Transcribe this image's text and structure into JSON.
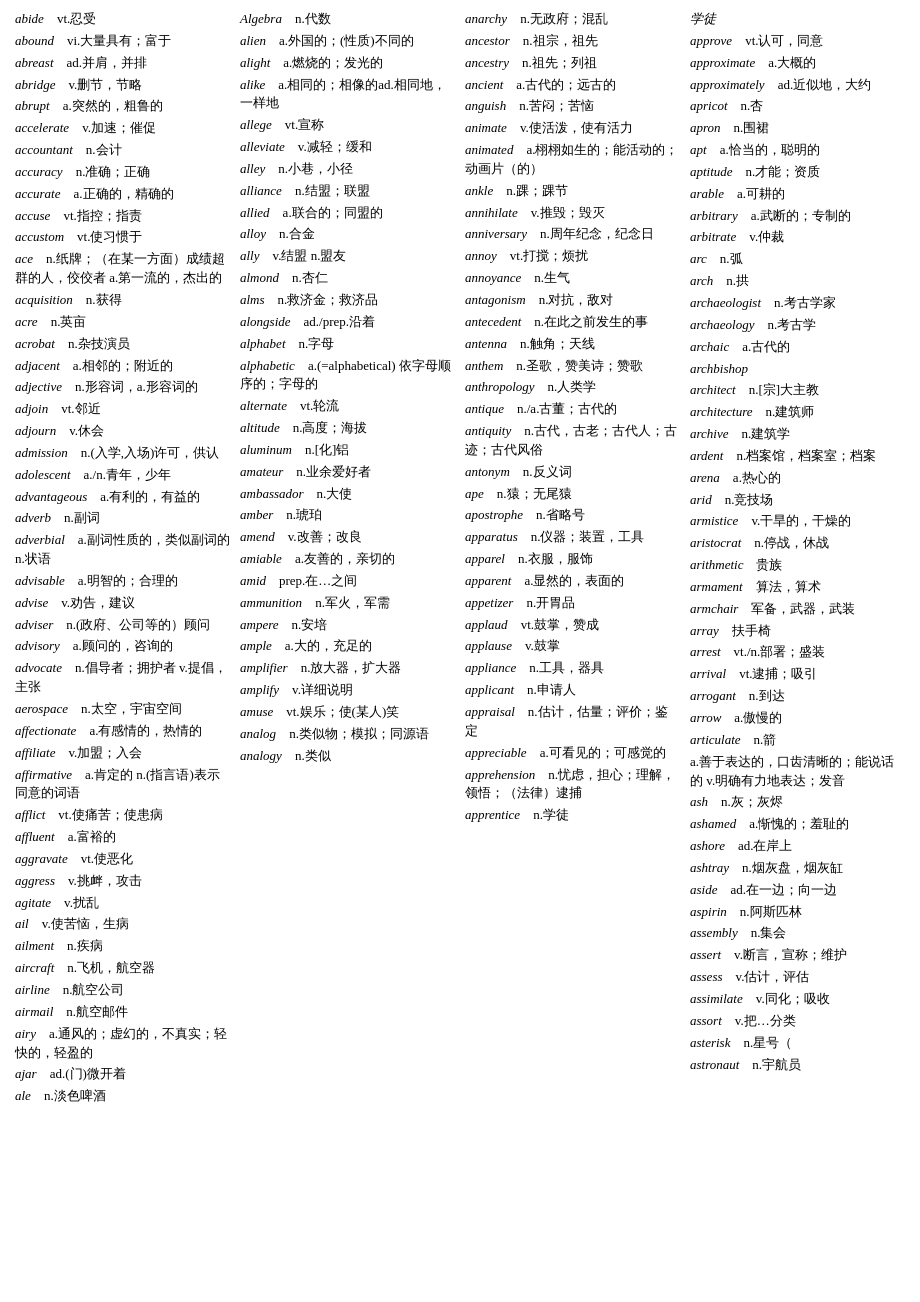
{
  "columns": [
    {
      "id": "col1",
      "entries": [
        {
          "word": "abide",
          "def": "vt.忍受"
        },
        {
          "word": "abound",
          "def": "vi.大量具有；富于"
        },
        {
          "word": "abreast",
          "def": "ad.并肩，并排"
        },
        {
          "word": "abridge",
          "def": "v.删节，节略"
        },
        {
          "word": "abrupt",
          "def": "a.突然的，粗鲁的"
        },
        {
          "word": "accelerate",
          "def": "v.加速；催促"
        },
        {
          "word": "accountant",
          "def": "n.会计"
        },
        {
          "word": "accuracy",
          "def": "n.准确；正确"
        },
        {
          "word": "accurate",
          "def": "a.正确的，精确的"
        },
        {
          "word": "accuse",
          "def": "vt.指控；指责"
        },
        {
          "word": "accustom",
          "def": "vt.使习惯于"
        },
        {
          "word": "ace",
          "def": "n.纸牌；（在某一方面）成绩超群的人，佼佼者 a.第一流的，杰出的"
        },
        {
          "word": "acquisition",
          "def": "n.获得"
        },
        {
          "word": "acre",
          "def": "n.英亩"
        },
        {
          "word": "acrobat",
          "def": "n.杂技演员"
        },
        {
          "word": "adjacent",
          "def": "a.相邻的；附近的"
        },
        {
          "word": "adjective",
          "def": "n.形容词，a.形容词的"
        },
        {
          "word": "adjoin",
          "def": "vt.邻近"
        },
        {
          "word": "adjourn",
          "def": "v.休会"
        },
        {
          "word": "admission",
          "def": "n.(入学,入场)许可，供认"
        },
        {
          "word": "adolescent",
          "def": "a./n.青年，少年"
        },
        {
          "word": "advantageous",
          "def": "a.有利的，有益的"
        },
        {
          "word": "adverb",
          "def": "n.副词"
        },
        {
          "word": "adverbial",
          "def": "a.副词性质的，类似副词的 n.状语"
        },
        {
          "word": "advisable",
          "def": "a.明智的；合理的"
        },
        {
          "word": "advise",
          "def": "v.劝告，建议"
        },
        {
          "word": "adviser",
          "def": "n.(政府、公司等的）顾问"
        },
        {
          "word": "advisory",
          "def": "a.顾问的，咨询的"
        },
        {
          "word": "advocate",
          "def": "n.倡导者；拥护者 v.提倡，主张"
        },
        {
          "word": "aerospace",
          "def": "n.太空，宇宙空间"
        },
        {
          "word": "affectionate",
          "def": "a.有感情的，热情的"
        },
        {
          "word": "affiliate",
          "def": "v.加盟；入会"
        },
        {
          "word": "affirmative",
          "def": "a.肯定的 n.(指言语)表示同意的词语"
        },
        {
          "word": "afflict",
          "def": "vt.使痛苦；使患病"
        },
        {
          "word": "affluent",
          "def": "a.富裕的"
        },
        {
          "word": "aggravate",
          "def": "vt.使恶化"
        },
        {
          "word": "aggress",
          "def": "v.挑衅，攻击"
        },
        {
          "word": "agitate",
          "def": "v.扰乱"
        },
        {
          "word": "ail",
          "def": "v.使苦恼，生病"
        },
        {
          "word": "ailment",
          "def": "n.疾病"
        },
        {
          "word": "aircraft",
          "def": "n.飞机，航空器"
        },
        {
          "word": "airline",
          "def": "n.航空公司"
        },
        {
          "word": "airmail",
          "def": "n.航空邮件"
        },
        {
          "word": "airy",
          "def": "a.通风的；虚幻的，不真实；轻快的，轻盈的"
        },
        {
          "word": "ajar",
          "def": "ad.(门)微开着"
        },
        {
          "word": "ale",
          "def": "n.淡色啤酒"
        }
      ]
    },
    {
      "id": "col2",
      "entries": [
        {
          "word": "Algebra",
          "def": "n.代数"
        },
        {
          "word": "alien",
          "def": "a.外国的；(性质)不同的"
        },
        {
          "word": "alight",
          "def": "a.燃烧的；发光的"
        },
        {
          "word": "alike",
          "def": "a.相同的；相像的ad.相同地，一样地"
        },
        {
          "word": "allege",
          "def": "vt.宣称"
        },
        {
          "word": "alleviate",
          "def": "v.减轻；缓和"
        },
        {
          "word": "alley",
          "def": "n.小巷，小径"
        },
        {
          "word": "alliance",
          "def": "n.结盟；联盟"
        },
        {
          "word": "allied",
          "def": "a.联合的；同盟的"
        },
        {
          "word": "alloy",
          "def": "n.合金"
        },
        {
          "word": "ally",
          "def": "v.结盟 n.盟友"
        },
        {
          "word": "almond",
          "def": "n.杏仁"
        },
        {
          "word": "alms",
          "def": "n.救济金；救济品"
        },
        {
          "word": "alongside",
          "def": "ad./prep.沿着"
        },
        {
          "word": "alphabet",
          "def": "n.字母"
        },
        {
          "word": "alphabetic",
          "def": "a.(=alphabetical) 依字母顺序的；字母的"
        },
        {
          "word": "alternate",
          "def": "vt.轮流"
        },
        {
          "word": "altitude",
          "def": "n.高度；海拔"
        },
        {
          "word": "aluminum",
          "def": "n.[化]铝"
        },
        {
          "word": "amateur",
          "def": "n.业余爱好者"
        },
        {
          "word": "ambassador",
          "def": "n.大使"
        },
        {
          "word": "amber",
          "def": "n.琥珀"
        },
        {
          "word": "amend",
          "def": "v.改善；改良"
        },
        {
          "word": "amiable",
          "def": "a.友善的，亲切的"
        },
        {
          "word": "amid",
          "def": "prep.在…之间"
        },
        {
          "word": "ammunition",
          "def": "n.军火，军需"
        },
        {
          "word": "ampere",
          "def": "n.安培"
        },
        {
          "word": "ample",
          "def": "a.大的，充足的"
        },
        {
          "word": "amplifier",
          "def": "n.放大器，扩大器"
        },
        {
          "word": "amplify",
          "def": "v.详细说明"
        },
        {
          "word": "amuse",
          "def": "vt.娱乐；使(某人)笑"
        },
        {
          "word": "analog",
          "def": "n.类似物；模拟；同源语"
        },
        {
          "word": "analogy",
          "def": "n.类似"
        }
      ]
    },
    {
      "id": "col3",
      "entries": [
        {
          "word": "anarchy",
          "def": "n.无政府；混乱"
        },
        {
          "word": "ancestor",
          "def": "n.祖宗，祖先"
        },
        {
          "word": "ancestry",
          "def": "n.祖先；列祖"
        },
        {
          "word": "ancient",
          "def": "a.古代的；远古的"
        },
        {
          "word": "anguish",
          "def": "n.苦闷；苦恼"
        },
        {
          "word": "animate",
          "def": "v.使活泼，使有活力"
        },
        {
          "word": "animated",
          "def": "a.栩栩如生的；能活动的；动画片（的）"
        },
        {
          "word": "ankle",
          "def": "n.踝；踝节"
        },
        {
          "word": "annihilate",
          "def": "v.推毁；毁灭"
        },
        {
          "word": "anniversary",
          "def": "n.周年纪念，纪念日"
        },
        {
          "word": "annoy",
          "def": "vt.打搅；烦扰"
        },
        {
          "word": "annoyance",
          "def": "n.生气"
        },
        {
          "word": "antagonism",
          "def": "n.对抗，敌对"
        },
        {
          "word": "antecedent",
          "def": "n.在此之前发生的事"
        },
        {
          "word": "antenna",
          "def": "n.触角；天线"
        },
        {
          "word": "anthem",
          "def": "n.圣歌，赞美诗；赞歌"
        },
        {
          "word": "anthropology",
          "def": "n.人类学"
        },
        {
          "word": "antique",
          "def": "n./a.古董；古代的"
        },
        {
          "word": "antiquity",
          "def": "n.古代，古老；古代人；古迹；古代风俗"
        },
        {
          "word": "antonym",
          "def": "n.反义词"
        },
        {
          "word": "ape",
          "def": "n.猿；无尾猿"
        },
        {
          "word": "apostrophe",
          "def": "n.省略号"
        },
        {
          "word": "apparatus",
          "def": "n.仪器；装置，工具"
        },
        {
          "word": "apparel",
          "def": "n.衣服，服饰"
        },
        {
          "word": "apparent",
          "def": "a.显然的，表面的"
        },
        {
          "word": "appetizer",
          "def": "n.开胃品"
        },
        {
          "word": "applaud",
          "def": "vt.鼓掌，赞成"
        },
        {
          "word": "applause",
          "def": "v.鼓掌"
        },
        {
          "word": "appliance",
          "def": "n.工具，器具"
        },
        {
          "word": "applicant",
          "def": "n.申请人"
        },
        {
          "word": "appraisal",
          "def": "n.估计，估量；评价；鉴定"
        },
        {
          "word": "appreciable",
          "def": "a.可看见的；可感觉的"
        },
        {
          "word": "apprehension",
          "def": "n.忧虑，担心；理解，领悟；（法律）逮捕"
        },
        {
          "word": "apprentice",
          "def": "n.学徒"
        }
      ]
    },
    {
      "id": "col4",
      "entries": [
        {
          "word": "学徒",
          "def": ""
        },
        {
          "word": "approve",
          "def": "vt.认可，同意"
        },
        {
          "word": "approximate",
          "def": "a.大概的"
        },
        {
          "word": "approximately",
          "def": "ad.近似地，大约"
        },
        {
          "word": "apricot",
          "def": "n.杏"
        },
        {
          "word": "apron",
          "def": "n.围裙"
        },
        {
          "word": "apt",
          "def": "a.恰当的，聪明的"
        },
        {
          "word": "aptitude",
          "def": "n.才能；资质"
        },
        {
          "word": "arable",
          "def": "a.可耕的"
        },
        {
          "word": "arbitrary",
          "def": "a.武断的；专制的"
        },
        {
          "word": "arbitrate",
          "def": "v.仲裁"
        },
        {
          "word": "arc",
          "def": "n.弧"
        },
        {
          "word": "arch",
          "def": "n.拱"
        },
        {
          "word": "archaeologist",
          "def": "n.考古学家"
        },
        {
          "word": "archaeology",
          "def": "n.考古学"
        },
        {
          "word": "archaic",
          "def": "a.古代的"
        },
        {
          "word": "archbishop",
          "def": ""
        },
        {
          "word": "architect",
          "def": "n.[宗]大主教"
        },
        {
          "word": "architecture",
          "def": "n.建筑师"
        },
        {
          "word": "archive",
          "def": "n.建筑学"
        },
        {
          "word": "ardent",
          "def": "n.档案馆，档案室；档案"
        },
        {
          "word": "arena",
          "def": "a.热心的"
        },
        {
          "word": "arid",
          "def": "n.竞技场"
        },
        {
          "word": "armistice",
          "def": "v.干旱的，干燥的"
        },
        {
          "word": "aristocrat",
          "def": "n.停战，休战"
        },
        {
          "word": "arithmetic",
          "def": "贵族"
        },
        {
          "word": "armament",
          "def": "算法，算术"
        },
        {
          "word": "armchair",
          "def": "军备，武器，武装"
        },
        {
          "word": "array",
          "def": "扶手椅"
        },
        {
          "word": "arrest",
          "def": "vt./n.部署；盛装"
        },
        {
          "word": "arrival",
          "def": "vt.逮捕；吸引"
        },
        {
          "word": "arrogant",
          "def": "n.到达"
        },
        {
          "word": "arrow",
          "def": "a.傲慢的"
        },
        {
          "word": "articulate",
          "def": "n.箭"
        },
        {
          "word": "",
          "def": "a.善于表达的，口齿清晰的；能说话的 v.明确有力地表达；发音"
        },
        {
          "word": "ash",
          "def": "n.灰；灰烬"
        },
        {
          "word": "ashamed",
          "def": "a.惭愧的；羞耻的"
        },
        {
          "word": "ashore",
          "def": "ad.在岸上"
        },
        {
          "word": "ashtray",
          "def": "n.烟灰盘，烟灰缸"
        },
        {
          "word": "aside",
          "def": "ad.在一边；向一边"
        },
        {
          "word": "aspirin",
          "def": "n.阿斯匹林"
        },
        {
          "word": "assembly",
          "def": "n.集会"
        },
        {
          "word": "assert",
          "def": "v.断言，宣称；维护"
        },
        {
          "word": "assess",
          "def": "v.估计，评估"
        },
        {
          "word": "assimilate",
          "def": "v.同化；吸收"
        },
        {
          "word": "assort",
          "def": "v.把…分类"
        },
        {
          "word": "asterisk",
          "def": "n.星号（"
        },
        {
          "word": "astronaut",
          "def": "n.宇航员"
        }
      ]
    }
  ]
}
